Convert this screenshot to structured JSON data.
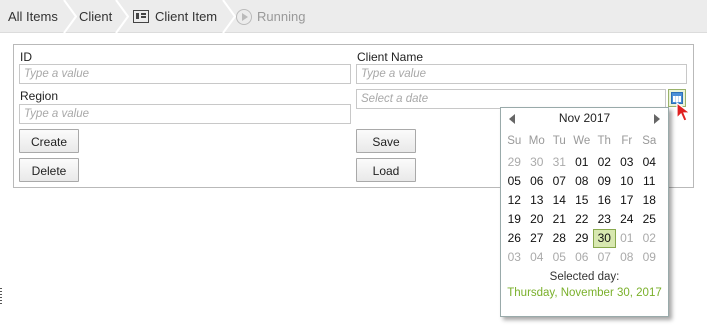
{
  "breadcrumb": {
    "items": [
      "All Items",
      "Client",
      "Client Item",
      "Running"
    ]
  },
  "form": {
    "id_label": "ID",
    "id_placeholder": "Type a value",
    "client_name_label": "Client Name",
    "client_name_placeholder": "Type a value",
    "region_label": "Region",
    "region_placeholder": "Type a value",
    "date_placeholder": "Select a date",
    "buttons": {
      "create": "Create",
      "save": "Save",
      "delete": "Delete",
      "load": "Load"
    }
  },
  "icons": {
    "calendar": "calendar-icon",
    "cursor": "mouse-pointer-icon",
    "item": "list-item-icon",
    "running": "play-circle-icon"
  },
  "colors": {
    "accent_green": "#7ab02b",
    "selected_bg": "#d8e8b0"
  },
  "datepicker": {
    "month_label": "Nov 2017",
    "weekdays": [
      "Su",
      "Mo",
      "Tu",
      "We",
      "Th",
      "Fr",
      "Sa"
    ],
    "weeks": [
      [
        "29",
        "30",
        "31",
        "01",
        "02",
        "03",
        "04"
      ],
      [
        "05",
        "06",
        "07",
        "08",
        "09",
        "10",
        "11"
      ],
      [
        "12",
        "13",
        "14",
        "15",
        "16",
        "17",
        "18"
      ],
      [
        "19",
        "20",
        "21",
        "22",
        "23",
        "24",
        "25"
      ],
      [
        "26",
        "27",
        "28",
        "29",
        "30",
        "01",
        "02"
      ],
      [
        "03",
        "04",
        "05",
        "06",
        "07",
        "08",
        "09"
      ]
    ],
    "muted": [
      [
        true,
        true,
        true,
        false,
        false,
        false,
        false
      ],
      [
        false,
        false,
        false,
        false,
        false,
        false,
        false
      ],
      [
        false,
        false,
        false,
        false,
        false,
        false,
        false
      ],
      [
        false,
        false,
        false,
        false,
        false,
        false,
        false
      ],
      [
        false,
        false,
        false,
        false,
        false,
        true,
        true
      ],
      [
        true,
        true,
        true,
        true,
        true,
        true,
        true
      ]
    ],
    "selected_day": "30",
    "selected_caption": "Selected day:",
    "selected_text": "Thursday, November 30, 2017"
  }
}
